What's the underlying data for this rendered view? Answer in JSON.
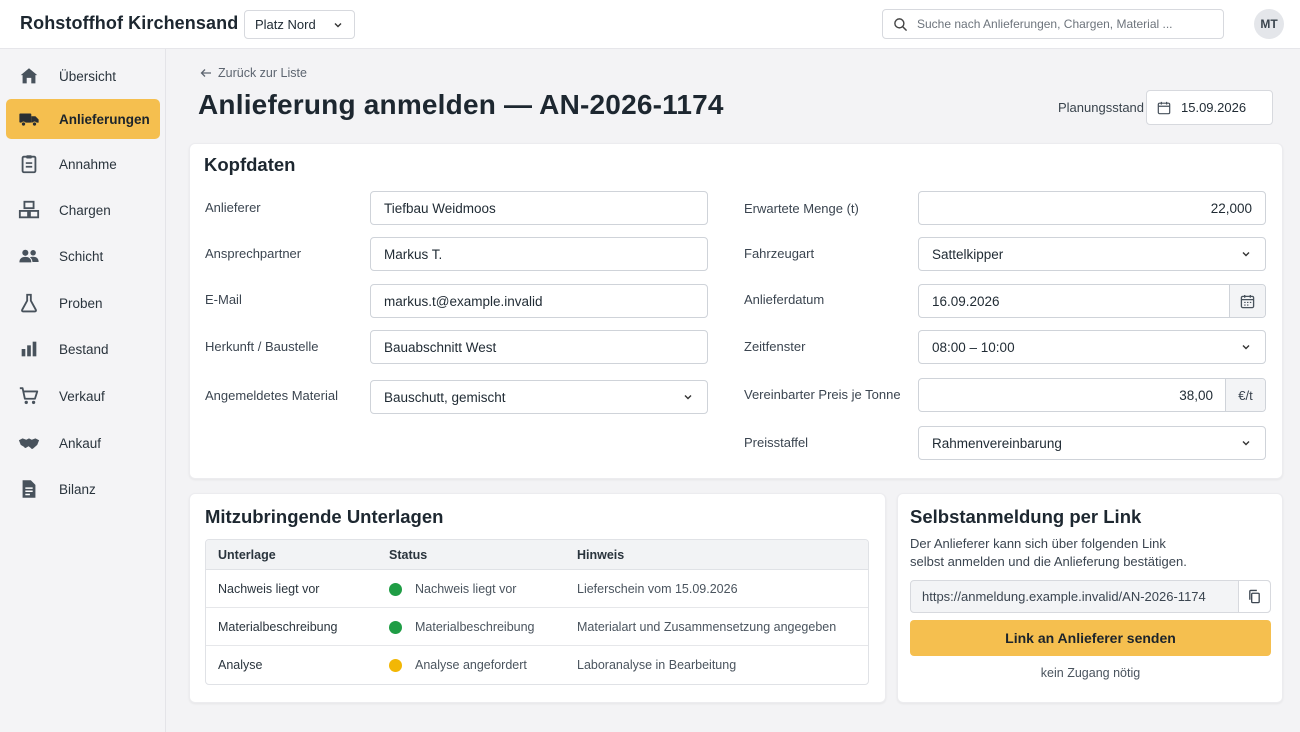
{
  "app": {
    "brand": "Rohstoffhof Kirchensand",
    "site": "Platz Nord",
    "search_placeholder": "Suche nach Anlieferungen, Chargen, Material ...",
    "user_initials": "MT"
  },
  "sidebar": {
    "items": [
      {
        "label": "Übersicht",
        "icon": "home-icon"
      },
      {
        "label": "Anlieferungen",
        "icon": "truck-icon",
        "active": true
      },
      {
        "label": "Annahme",
        "icon": "clipboard-icon"
      },
      {
        "label": "Chargen",
        "icon": "boxes-icon"
      },
      {
        "label": "Schicht",
        "icon": "people-icon"
      },
      {
        "label": "Proben",
        "icon": "flask-icon"
      },
      {
        "label": "Bestand",
        "icon": "bar-chart-icon"
      },
      {
        "label": "Verkauf",
        "icon": "cart-icon"
      },
      {
        "label": "Ankauf",
        "icon": "handshake-icon"
      },
      {
        "label": "Bilanz",
        "icon": "document-icon"
      }
    ]
  },
  "header": {
    "back_label": "Zurück zur Liste",
    "title": "Anlieferung anmelden — AN-2026-1174",
    "plan_label": "Planungsstand",
    "plan_date": "15.09.2026"
  },
  "kopfdaten": {
    "title": "Kopfdaten",
    "left": [
      {
        "label": "Anlieferer",
        "value": "Tiefbau Weidmoos"
      },
      {
        "label": "Ansprechpartner",
        "value": "Markus T."
      },
      {
        "label": "E-Mail",
        "value": "markus.t@example.invalid"
      },
      {
        "label": "Herkunft / Baustelle",
        "value": "Bauabschnitt West"
      },
      {
        "label": "Angemeldetes Material",
        "value": "Bauschutt, gemischt"
      }
    ],
    "right": [
      {
        "label": "Erwartete Menge (t)",
        "value": "22,000"
      },
      {
        "label": "Fahrzeugart",
        "value": "Sattelkipper"
      },
      {
        "label": "Anlieferdatum",
        "value": "16.09.2026"
      },
      {
        "label": "Zeitfenster",
        "value": "08:00 – 10:00"
      },
      {
        "label": "Vereinbarter Preis je Tonne",
        "value": "38,00",
        "unit": "€/t"
      },
      {
        "label": "Preisstaffel",
        "value": "Rahmenvereinbarung"
      }
    ]
  },
  "unterlagen": {
    "title": "Mitzubringende Unterlagen",
    "columns": [
      "Unterlage",
      "Status",
      "Hinweis"
    ],
    "rows": [
      {
        "unterlage": "Nachweis liegt vor",
        "status": "Nachweis liegt vor",
        "status_color": "#1f9d45",
        "hinweis": "Lieferschein vom 15.09.2026"
      },
      {
        "unterlage": "Materialbeschreibung",
        "status": "Materialbeschreibung",
        "status_color": "#1f9d45",
        "hinweis": "Materialart und Zusammensetzung angegeben"
      },
      {
        "unterlage": "Analyse",
        "status": "Analyse angefordert",
        "status_color": "#f2b705",
        "hinweis": "Laboranalyse in Bearbeitung"
      }
    ]
  },
  "selbstanmeldung": {
    "title": "Selbstanmeldung per Link",
    "description_line1": "Der Anlieferer kann sich über folgenden Link",
    "description_line2": "selbst anmelden und die Anlieferung bestätigen.",
    "link": "https://anmeldung.example.invalid/AN-2026-1174",
    "send_label": "Link an Anlieferer senden",
    "note": "kein Zugang nötig"
  },
  "colors": {
    "accent": "#f5bf4f",
    "status_ok": "#1f9d45",
    "status_pending": "#f2b705"
  }
}
